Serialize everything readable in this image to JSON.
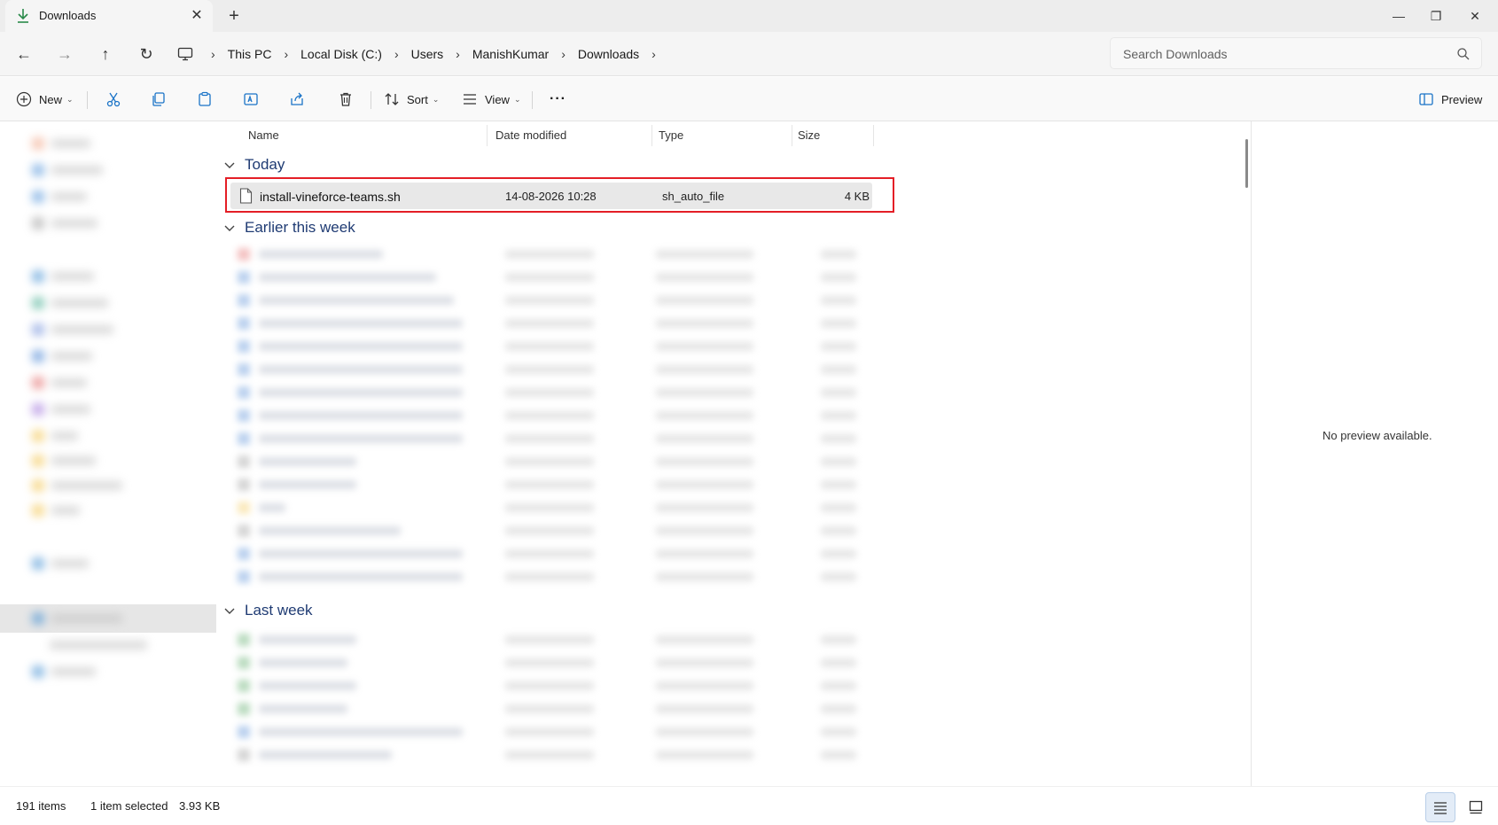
{
  "window": {
    "tab_title": "Downloads",
    "tab_close": "✕",
    "tab_add": "+",
    "minimize": "—",
    "maximize": "❐",
    "close": "✕"
  },
  "address": {
    "back": "←",
    "forward": "→",
    "up": "↑",
    "refresh": "↻",
    "crumbs": [
      "This PC",
      "Local Disk (C:)",
      "Users",
      "ManishKumar",
      "Downloads"
    ],
    "separator": "›",
    "search_placeholder": "Search Downloads"
  },
  "toolbar": {
    "new_label": "New",
    "sort_label": "Sort",
    "view_label": "View",
    "more_label": "···",
    "preview_label": "Preview",
    "chevron": "⌄"
  },
  "columns": {
    "name": "Name",
    "date_modified": "Date modified",
    "type": "Type",
    "size": "Size"
  },
  "groups": {
    "today": "Today",
    "earlier": "Earlier this week",
    "last_week": "Last week"
  },
  "selected_file": {
    "name": "install-vineforce-teams.sh",
    "date": "14-08-2026 10:28",
    "type": "sh_auto_file",
    "size": "4 KB"
  },
  "preview": {
    "message": "No preview available."
  },
  "status": {
    "item_count": "191 items",
    "selection": "1 item selected",
    "selection_size": "3.93 KB"
  },
  "colors": {
    "accent": "#1f3b73",
    "highlight": "#e41e26",
    "download_icon": "#2a8a4a"
  }
}
